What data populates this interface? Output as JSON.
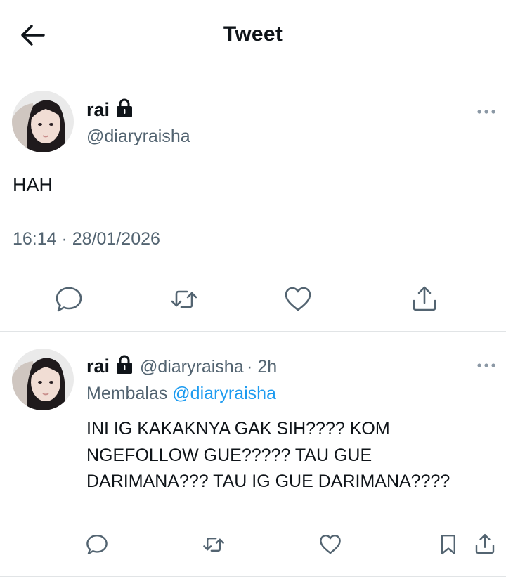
{
  "header": {
    "title": "Tweet"
  },
  "main_tweet": {
    "name": "rai",
    "handle": "@diaryraisha",
    "text": "HAH",
    "timestamp": "16:14 · 28/01/2026"
  },
  "reply": {
    "name": "rai",
    "handle": "@diaryraisha",
    "time": "· 2h",
    "replying_prefix": "Membalas",
    "replying_handle": "@diaryraisha",
    "text": "INI IG KAKAKNYA GAK SIH???? KOM NGEFOLLOW GUE????? TAU GUE DARIMANA??? TAU IG GUE DARIMANA????"
  },
  "icons": {
    "back": "arrow-left-icon",
    "lock": "lock-icon",
    "more": "more-icon",
    "reply": "reply-icon",
    "retweet": "retweet-icon",
    "like": "heart-icon",
    "share": "share-icon",
    "bookmark": "bookmark-icon"
  },
  "colors": {
    "text": "#0f1419",
    "secondary": "#536471",
    "mention": "#1d9bf0"
  }
}
